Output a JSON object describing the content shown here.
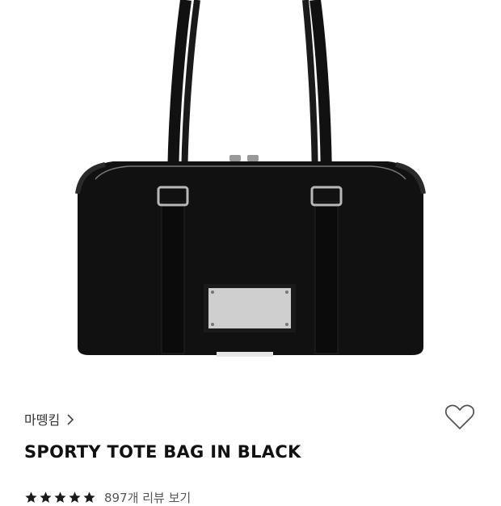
{
  "product": {
    "image_alt": "black sporty tote bag",
    "brand": "마뗑킴",
    "title": "SPORTY TOTE BAG IN BLACK",
    "rating_stars": 5,
    "review_link": "897개 리뷰 보기"
  },
  "icons": {
    "brand_chevron": "chevron-right-icon",
    "wishlist": "heart-outline-icon",
    "star": "star-icon"
  },
  "colors": {
    "bag": "#111111",
    "star": "#1a1a1a",
    "text": "#111111"
  }
}
